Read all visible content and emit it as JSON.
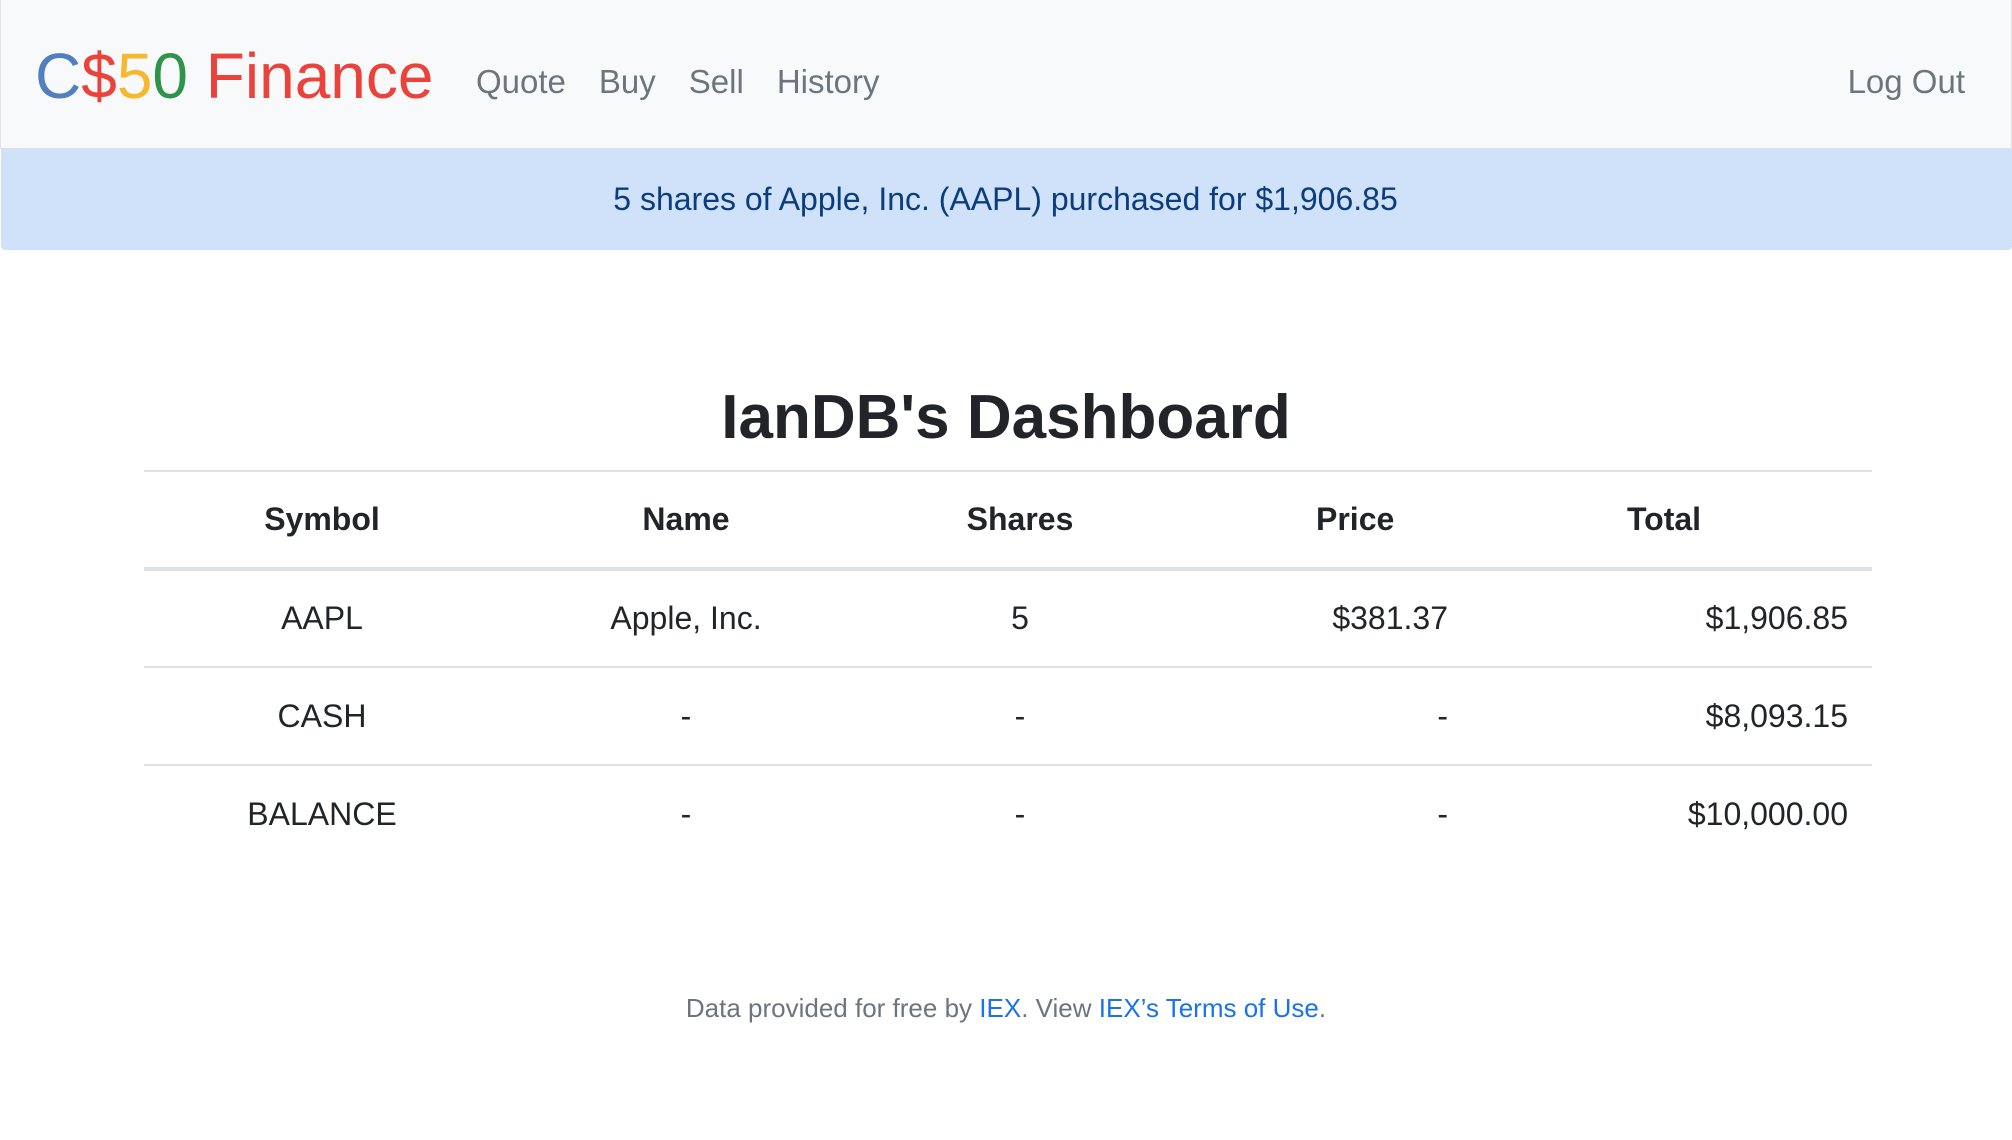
{
  "brand": {
    "part1": "C",
    "part2": "$",
    "part3": "5",
    "part4": "0",
    "part5": " Finance",
    "colors": [
      "#537fbe",
      "#ea433b",
      "#f5b82e",
      "#2e944b",
      "#ea433b"
    ]
  },
  "nav": {
    "items": [
      "Quote",
      "Buy",
      "Sell",
      "History"
    ],
    "logout": "Log Out"
  },
  "alert": {
    "message": "5 shares of Apple, Inc. (AAPL) purchased for $1,906.85"
  },
  "dashboard": {
    "title": "IanDB's Dashboard"
  },
  "table": {
    "headers": [
      "Symbol",
      "Name",
      "Shares",
      "Price",
      "Total"
    ],
    "rows": [
      [
        "AAPL",
        "Apple, Inc.",
        "5",
        "$381.37",
        "$1,906.85"
      ],
      [
        "CASH",
        "-",
        "-",
        "-",
        "$8,093.15"
      ],
      [
        "BALANCE",
        "-",
        "-",
        "-",
        "$10,000.00"
      ]
    ]
  },
  "footer": {
    "prefix": "Data provided for free by ",
    "link1": "IEX",
    "middle": ". View ",
    "link2": "IEX’s Terms of Use",
    "suffix": "."
  }
}
